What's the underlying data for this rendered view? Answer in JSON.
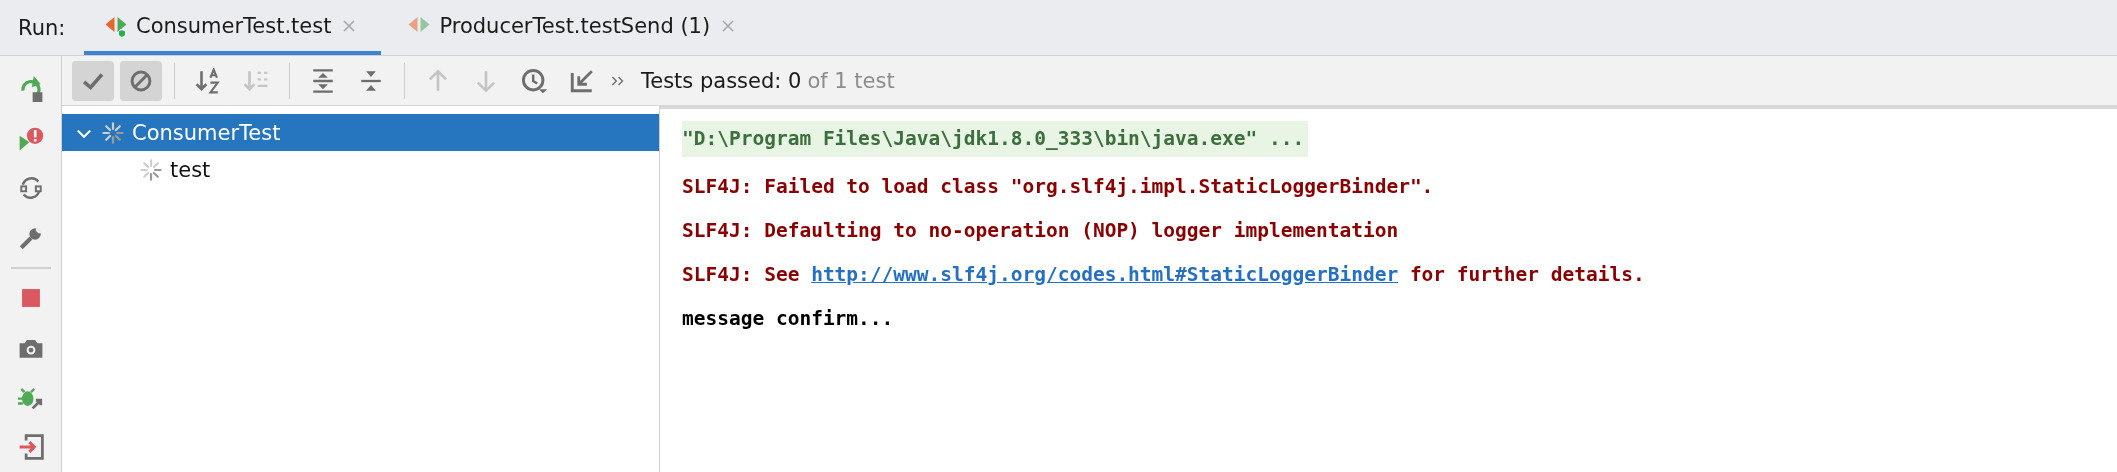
{
  "run_label": "Run:",
  "tabs": [
    {
      "label": "ConsumerTest.test",
      "selected": true
    },
    {
      "label": "ProducerTest.testSend (1)",
      "selected": false
    }
  ],
  "toolbar": {
    "filters": [
      {
        "selected": true
      },
      {
        "selected": true
      }
    ],
    "actions": [
      {
        "disabled": false
      },
      {
        "disabled": true
      },
      {
        "disabled": false
      },
      {
        "disabled": false
      },
      {
        "disabled": true
      },
      {
        "disabled": true
      },
      {
        "disabled": false
      },
      {
        "disabled": false
      }
    ]
  },
  "status": {
    "passed": "Tests passed: 0",
    "total": "of 1 test"
  },
  "tree": [
    {
      "label": "ConsumerTest",
      "selected": true,
      "expanded": true,
      "children": [
        {
          "label": "test",
          "selected": false
        }
      ]
    }
  ],
  "console": [
    {
      "kind": "command",
      "parts": [
        {
          "text": "\"D:\\Program Files\\Java\\jdk1.8.0_333\\bin\\java.exe\" ..."
        }
      ]
    },
    {
      "kind": "error",
      "parts": [
        {
          "text": "SLF4J: Failed to load class \"org.slf4j.impl.StaticLoggerBinder\"."
        }
      ]
    },
    {
      "kind": "error",
      "parts": [
        {
          "text": "SLF4J: Defaulting to no-operation (NOP) logger implementation"
        }
      ]
    },
    {
      "kind": "error",
      "parts": [
        {
          "text": "SLF4J: See "
        },
        {
          "text": "http://www.slf4j.org/codes.html#StaticLoggerBinder",
          "kind": "link"
        },
        {
          "text": " for further details."
        }
      ]
    },
    {
      "kind": "output",
      "parts": [
        {
          "text": "message confirm..."
        }
      ]
    }
  ]
}
